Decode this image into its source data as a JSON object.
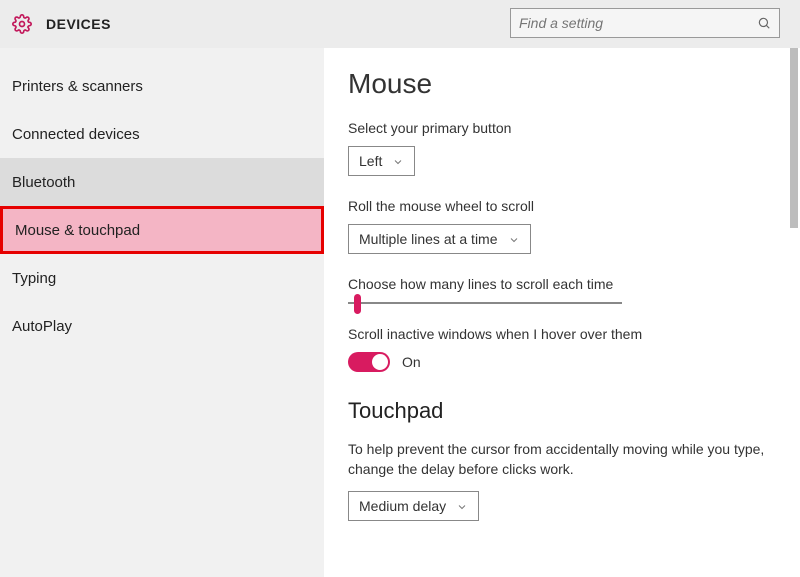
{
  "header": {
    "title": "DEVICES",
    "search_placeholder": "Find a setting"
  },
  "sidebar": {
    "items": [
      {
        "label": "Printers & scanners"
      },
      {
        "label": "Connected devices"
      },
      {
        "label": "Bluetooth"
      },
      {
        "label": "Mouse & touchpad"
      },
      {
        "label": "Typing"
      },
      {
        "label": "AutoPlay"
      }
    ],
    "selected_index": 3,
    "hover_index": 2
  },
  "main": {
    "mouse": {
      "heading": "Mouse",
      "primary_button_label": "Select your primary button",
      "primary_button_value": "Left",
      "scroll_mode_label": "Roll the mouse wheel to scroll",
      "scroll_mode_value": "Multiple lines at a time",
      "lines_label": "Choose how many lines to scroll each time",
      "inactive_label": "Scroll inactive windows when I hover over them",
      "inactive_value": "On"
    },
    "touchpad": {
      "heading": "Touchpad",
      "desc": "To help prevent the cursor from accidentally moving while you type, change the delay before clicks work.",
      "delay_value": "Medium delay"
    }
  }
}
